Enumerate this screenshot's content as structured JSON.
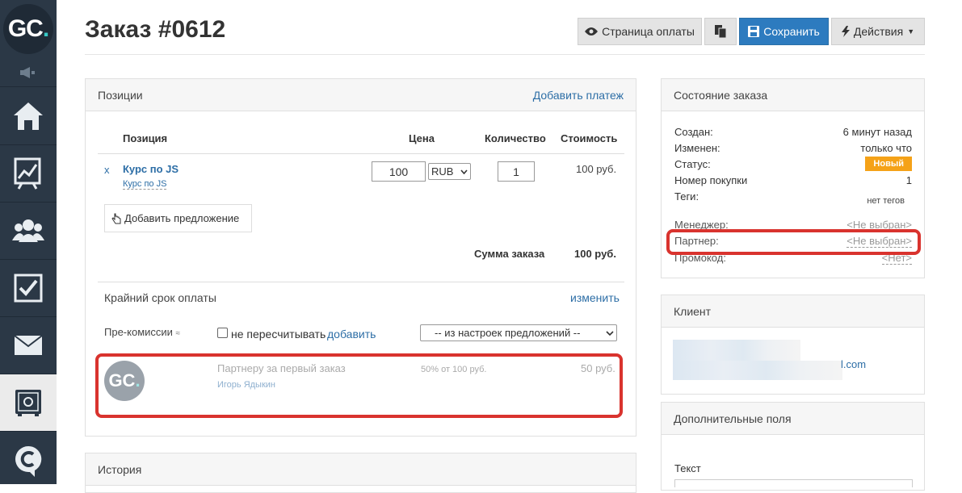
{
  "app": {
    "logo_text": "GC",
    "logo_dot": "."
  },
  "sidebar": {
    "items": [
      {
        "icon": "home-icon"
      },
      {
        "icon": "chart-icon"
      },
      {
        "icon": "users-icon"
      },
      {
        "icon": "checkbox-icon"
      },
      {
        "icon": "mail-icon"
      },
      {
        "icon": "safe-icon",
        "active": true
      },
      {
        "icon": "chat-icon"
      }
    ]
  },
  "header": {
    "title": "Заказ #0612",
    "btn_payment_page": "Страница оплаты",
    "btn_save": "Сохранить",
    "btn_actions": "Действия"
  },
  "positions": {
    "panel_title": "Позиции",
    "add_payment": "Добавить платеж",
    "col_position": "Позиция",
    "col_price": "Цена",
    "col_quantity": "Количество",
    "col_cost": "Стоимость",
    "row": {
      "remove": "x",
      "title": "Курс по JS",
      "subtitle": "Курс по JS",
      "price": "100",
      "currency": "RUB",
      "quantity": "1",
      "cost": "100 руб."
    },
    "add_offer": "Добавить предложение",
    "total_label": "Сумма заказа",
    "total_value": "100 руб.",
    "deadline_label": "Крайний срок оплаты",
    "deadline_change": "изменить",
    "precommission_label": "Пре-комиссии",
    "precommission_sign": "≈",
    "no_recalc_label": "не пересчитывать",
    "add_link": "добавить",
    "offer_select": "-- из настроек предложений --",
    "partner_row": {
      "avatar_text": "GC",
      "title": "Партнеру за первый заказ",
      "name": "Игорь Ядыкин",
      "percent": "50% от 100 руб.",
      "amount": "50 руб."
    }
  },
  "history": {
    "panel_title": "История"
  },
  "order_state": {
    "panel_title": "Состояние заказа",
    "rows": [
      {
        "label": "Создан:",
        "value": "6 минут назад"
      },
      {
        "label": "Изменен:",
        "value": "только что"
      },
      {
        "label": "Статус:",
        "value": "Новый"
      },
      {
        "label": "Номер покупки",
        "value": "1"
      },
      {
        "label": "Теги:",
        "value": "нет тегов"
      },
      {
        "label": "Менеджер:",
        "value": "<Не выбран>"
      },
      {
        "label": "Партнер:",
        "value": "<Не выбран>"
      },
      {
        "label": "Промокод:",
        "value": "<Нет>"
      }
    ]
  },
  "client": {
    "panel_title": "Клиент",
    "email_suffix": "l.com"
  },
  "extra_fields": {
    "panel_title": "Дополнительные поля",
    "text_label": "Текст"
  },
  "colors": {
    "sidebar_bg": "#2b3846",
    "primary": "#2d7bbf",
    "badge": "#f5a218",
    "highlight": "#d9332e",
    "link": "#2d6ea6"
  }
}
